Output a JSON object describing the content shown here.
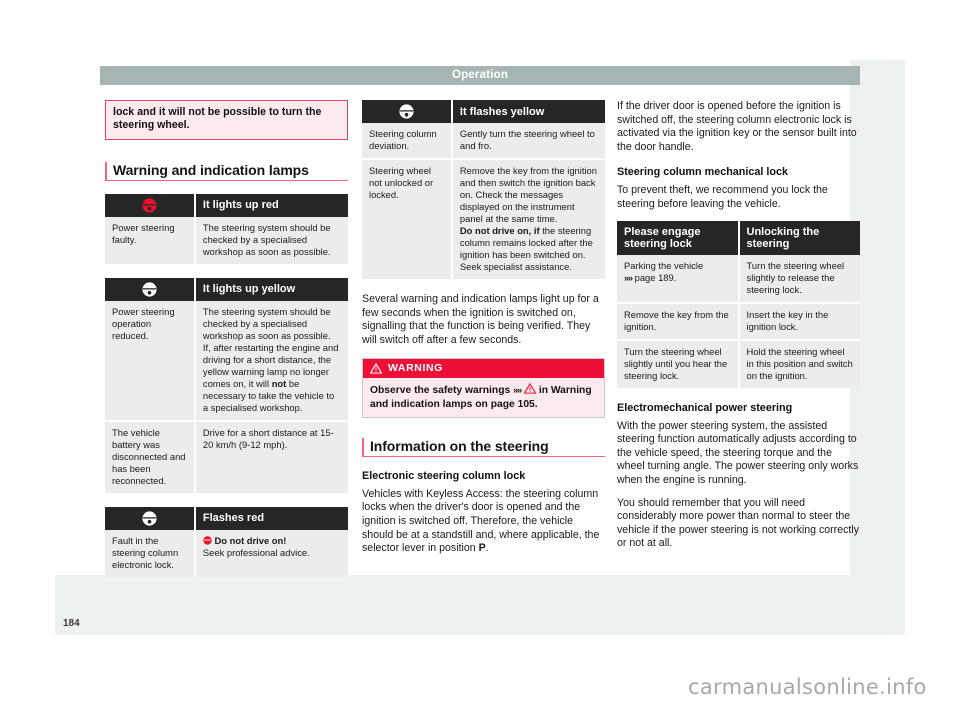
{
  "header": {
    "title": "Operation"
  },
  "footer": {
    "page_number": "184",
    "watermark": "carmanualsonline.info"
  },
  "colors": {
    "header_bar": "#a6b5b4",
    "accent_pink": "#f0657f",
    "warning_red": "#ed0f35",
    "table_header": "#262626",
    "table_cell": "#ececec",
    "icon_red": "#e8112d"
  },
  "column1": {
    "note_box": {
      "text": "lock and it will not be possible to turn the steering wheel."
    },
    "section_title": "Warning and indication lamps",
    "table_red": {
      "icon": "steering-wheel-red-icon",
      "header": "It lights up red",
      "rows": [
        {
          "cause": "Power steering faulty.",
          "action": "The steering system should be checked by a specialised workshop as soon as possible."
        }
      ]
    },
    "table_yellow": {
      "icon": "steering-wheel-white-icon",
      "header": "It lights up yellow",
      "rows": [
        {
          "cause": "Power steering operation reduced.",
          "action_part1": "The steering system should be checked by a specialised workshop as soon as possible.",
          "action_part2_a": "If, after restarting the engine and driving for a short distance, the yellow warning lamp no longer comes on, it will ",
          "action_part2_bold": "not",
          "action_part2_b": " be necessary to take the vehicle to a specialised workshop."
        },
        {
          "cause": "The vehicle battery was disconnected and has been reconnected.",
          "action": "Drive for a short distance at 15-20 km/h (9-12 mph)."
        }
      ]
    },
    "table_flashes_red": {
      "icon": "steering-wheel-white-icon",
      "header": "Flashes red",
      "rows": [
        {
          "cause": "Fault in the steering column electronic lock.",
          "action_bold": "Do not drive on!",
          "action_rest": "Seek professional advice.",
          "action_icon": "red-circle-icon"
        }
      ]
    }
  },
  "column2": {
    "table_flashes_yellow": {
      "icon": "steering-wheel-white-icon",
      "header": "It flashes yellow",
      "rows": [
        {
          "cause": "Steering column deviation.",
          "action": "Gently turn the steering wheel to and fro."
        },
        {
          "cause": "Steering wheel not unlocked or locked.",
          "action_part1": "Remove the key from the ignition and then switch the ignition back on. Check the messages displayed on the instrument panel at the same time.",
          "action_bold": "Do not drive on, if",
          "action_part2": " the steering column remains locked after the ignition has been switched on. Seek specialist assistance."
        }
      ]
    },
    "paragraph": "Several warning and indication lamps light up for a few seconds when the ignition is switched on, signalling that the function is being verified. They will switch off after a few seconds.",
    "warning_box": {
      "icon": "warning-triangle-icon",
      "title": "WARNING",
      "text_part1": "Observe the safety warnings ",
      "arrows": "»»",
      "inline_icon": "warning-triangle-outline-icon",
      "text_part2": " in Warning and indication lamps on page 105."
    },
    "section_title": "Information on the steering",
    "sub_heading": "Electronic steering column lock",
    "paragraph2_part1": "Vehicles with Keyless Access: the steering column locks when the driver's door is opened and the ignition is switched off. Therefore, the vehicle should be at a standstill and, where applicable, the selector lever in position ",
    "paragraph2_bold": "P",
    "paragraph2_part2": "."
  },
  "column3": {
    "paragraph1": "If the driver door is opened before the ignition is switched off, the steering column electronic lock is activated via the ignition key or the sensor built into the door handle.",
    "sub_heading1": "Steering column mechanical lock",
    "paragraph2": "To prevent theft, we recommend you lock the steering before leaving the vehicle.",
    "table_lock": {
      "headers": [
        "Please engage steering lock",
        "Unlocking the steering"
      ],
      "rows": [
        {
          "left_part1": "Parking the vehicle",
          "left_arrows": "»»",
          "left_part2": " page 189.",
          "right": "Turn the steering wheel slightly to release the steering lock."
        },
        {
          "left": "Remove the key from the ignition.",
          "right": "Insert the key in the ignition lock."
        },
        {
          "left": "Turn the steering wheel slightly until you hear the steering lock.",
          "right": "Hold the steering wheel in this position and switch on the ignition."
        }
      ]
    },
    "sub_heading2": "Electromechanical power steering",
    "paragraph3": "With the power steering system, the assisted steering function automatically adjusts according to the vehicle speed, the steering torque and the wheel turning angle. The power steering only works when the engine is running.",
    "paragraph4": "You should remember that you will need considerably more power than normal to steer the vehicle if the power steering is not working correctly or not at all."
  }
}
